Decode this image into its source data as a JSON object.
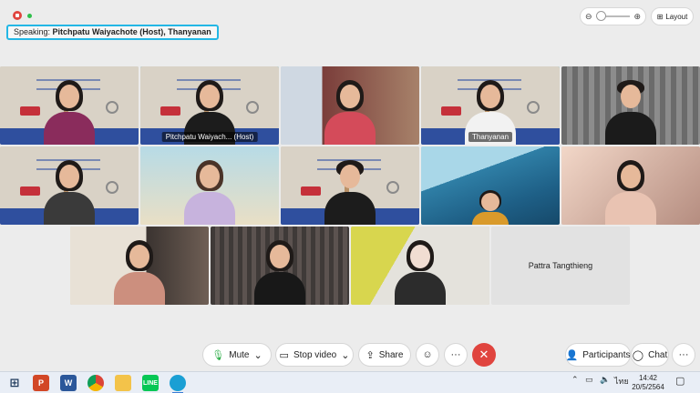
{
  "meeting": {
    "speaking_label": "Speaking:",
    "speaking_names": "Pitchpatu Waiyachote (Host), Thanyanan",
    "layout_label": "Layout"
  },
  "tiles": [
    {
      "name": "",
      "active": false
    },
    {
      "name": "Pitchpatu Waiyach... (Host)",
      "active": true
    },
    {
      "name": "",
      "active": false
    },
    {
      "name": "Thanyanan",
      "active": true
    },
    {
      "name": "",
      "active": false
    },
    {
      "name": "",
      "active": false
    },
    {
      "name": "",
      "active": false
    },
    {
      "name": "",
      "active": false
    },
    {
      "name": "",
      "active": false
    },
    {
      "name": "",
      "active": false
    },
    {
      "name": "",
      "active": false
    },
    {
      "name": "",
      "active": false
    },
    {
      "name": "",
      "active": false
    },
    {
      "name": "Pattra Tangthieng",
      "active": false
    }
  ],
  "toolbar": {
    "mute_label": "Mute",
    "stop_video_label": "Stop video",
    "share_label": "Share",
    "participants_label": "Participants",
    "chat_label": "Chat",
    "more_label": "···"
  },
  "taskbar": {
    "time": "14:42",
    "date": "20/5/2564",
    "lang": "ไทย"
  },
  "colors": {
    "accent": "#23b7e5",
    "end_call": "#e0443e"
  }
}
